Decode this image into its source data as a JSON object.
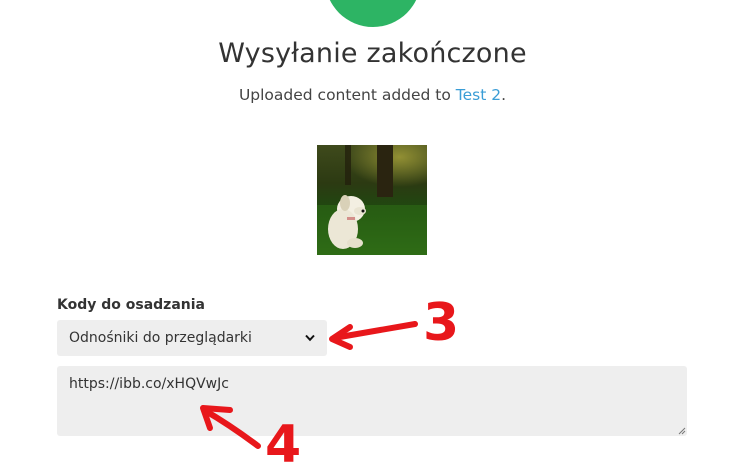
{
  "header": {
    "title": "Wysyłanie zakończone",
    "subtitle_prefix": "Uploaded content added to ",
    "album_link": "Test 2",
    "subtitle_suffix": "."
  },
  "upload": {
    "thumbnail_icon": "dog-photo-thumbnail"
  },
  "embed": {
    "label": "Kody do osadzania",
    "selected_option": "Odnośniki do przeglądarki",
    "code_value": "https://ibb.co/xHQVwJc"
  },
  "annotations": {
    "arrow_3_label": "3",
    "arrow_4_label": "4"
  },
  "colors": {
    "success": "#2db464",
    "link": "#3a9dd6",
    "field_bg": "#eeeeee",
    "annotation": "#e8171b"
  }
}
